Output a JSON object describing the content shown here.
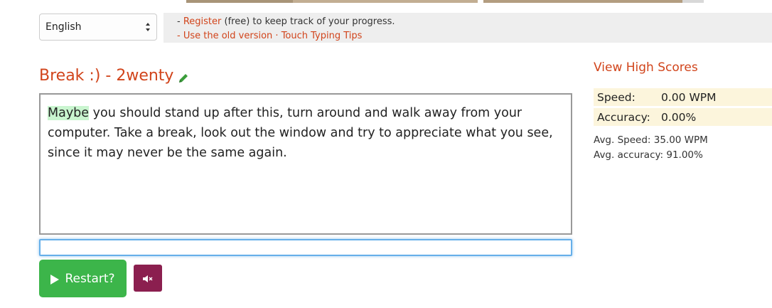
{
  "language_select": {
    "value": "English"
  },
  "top_links": {
    "prefix1": "- ",
    "register": "Register",
    "register_suffix": " (free) to keep track of your progress.",
    "prefix2": "- ",
    "old_version": "Use the old version",
    "separator": " · ",
    "tips": "Touch Typing Tips"
  },
  "test": {
    "title": "Break :) - 2wenty",
    "current_word": "Maybe",
    "remaining_text": " you should stand up after this, turn around and walk away from your computer. Take a break, look out the window and try to appreciate what you see, since it may never be the same again."
  },
  "input": {
    "value": ""
  },
  "buttons": {
    "restart": "Restart?"
  },
  "sidebar": {
    "high_scores": "View High Scores",
    "speed_label": "Speed:",
    "speed_value": "0.00 WPM",
    "accuracy_label": "Accuracy:",
    "accuracy_value": "0.00%",
    "avg_speed": "Avg. Speed: 35.00 WPM",
    "avg_accuracy": "Avg. accuracy: 91.00%"
  },
  "colors": {
    "accent": "#d1441b",
    "highlight": "#c9f5cf",
    "restart_bg": "#3cb54a",
    "mute_bg": "#8b1f4f",
    "stat_bg": "#fcf5dc"
  },
  "icons": {
    "edit": "pencil-icon",
    "restart": "play-icon",
    "mute": "speaker-mute-icon",
    "select": "updown-arrows-icon"
  }
}
